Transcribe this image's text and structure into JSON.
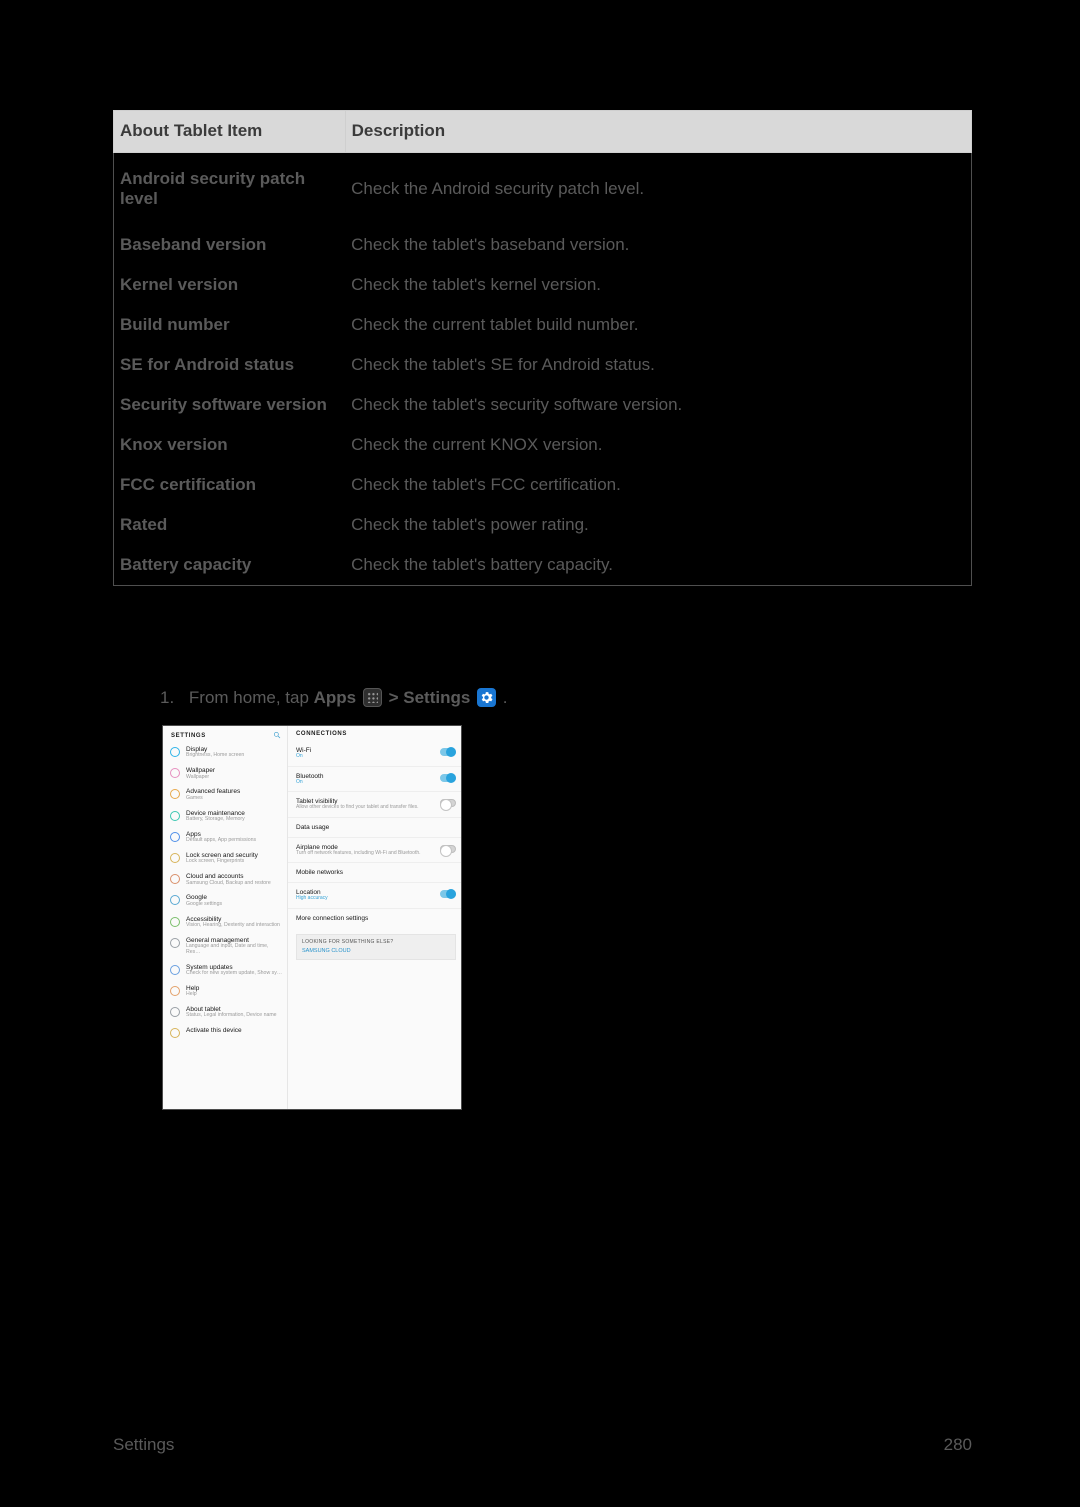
{
  "table": {
    "headers": {
      "item": "About Tablet Item",
      "desc": "Description"
    },
    "rows": [
      {
        "item": "Android security patch level",
        "desc": "Check the Android security patch level."
      },
      {
        "item": "Baseband version",
        "desc": "Check the tablet's baseband version."
      },
      {
        "item": "Kernel version",
        "desc": "Check the tablet's kernel version."
      },
      {
        "item": "Build number",
        "desc": "Check the current tablet build number."
      },
      {
        "item": "SE for Android status",
        "desc": "Check the tablet's SE for Android status."
      },
      {
        "item": "Security software version",
        "desc": "Check the tablet's security software version."
      },
      {
        "item": "Knox version",
        "desc": "Check the current KNOX version."
      },
      {
        "item": "FCC certification",
        "desc": "Check the tablet's FCC certification."
      },
      {
        "item": "Rated",
        "desc": "Check the tablet's power rating."
      },
      {
        "item": "Battery capacity",
        "desc": "Check the tablet's battery capacity."
      }
    ]
  },
  "instruction": {
    "num": "1.",
    "prefix": "From home, tap ",
    "apps": "Apps",
    "sep": " > ",
    "settings": "Settings",
    "period": "."
  },
  "screenshot": {
    "sidebar_title": "SETTINGS",
    "sidebar": [
      {
        "label": "Display",
        "sub": "Brightness, Home screen",
        "color": "#2fb4e8"
      },
      {
        "label": "Wallpaper",
        "sub": "Wallpaper",
        "color": "#e68fbf"
      },
      {
        "label": "Advanced features",
        "sub": "Games",
        "color": "#e7a84a"
      },
      {
        "label": "Device maintenance",
        "sub": "Battery, Storage, Memory",
        "color": "#3cc7b2"
      },
      {
        "label": "Apps",
        "sub": "Default apps, App permissions",
        "color": "#4f8fe8"
      },
      {
        "label": "Lock screen and security",
        "sub": "Lock screen, Fingerprints",
        "color": "#d7b45a"
      },
      {
        "label": "Cloud and accounts",
        "sub": "Samsung Cloud, Backup and restore",
        "color": "#d98f6a"
      },
      {
        "label": "Google",
        "sub": "Google settings",
        "color": "#5aa9d3"
      },
      {
        "label": "Accessibility",
        "sub": "Vision, Hearing, Dexterity and interaction",
        "color": "#7bbf6c"
      },
      {
        "label": "General management",
        "sub": "Language and input, Date and time, Res…",
        "color": "#9aa0a6"
      },
      {
        "label": "System updates",
        "sub": "Check for new system update, Show sy…",
        "color": "#6aa0e0"
      },
      {
        "label": "Help",
        "sub": "Help",
        "color": "#e3a16a"
      },
      {
        "label": "About tablet",
        "sub": "Status, Legal information, Device name",
        "color": "#9aa0a6"
      },
      {
        "label": "Activate this device",
        "sub": "",
        "color": "#d7b45a"
      }
    ],
    "panel_title": "CONNECTIONS",
    "panel": [
      {
        "label": "Wi-Fi",
        "sub": "On",
        "sub_accent": true,
        "toggle": "on"
      },
      {
        "label": "Bluetooth",
        "sub": "On",
        "sub_accent": true,
        "toggle": "on"
      },
      {
        "label": "Tablet visibility",
        "sub": "Allow other devices to find your tablet and transfer files.",
        "toggle": "off"
      },
      {
        "label": "Data usage",
        "sub": "",
        "toggle": null
      },
      {
        "label": "Airplane mode",
        "sub": "Turn off network features, including Wi-Fi and Bluetooth.",
        "toggle": "off"
      },
      {
        "label": "Mobile networks",
        "sub": "",
        "toggle": null
      },
      {
        "label": "Location",
        "sub": "High accuracy",
        "sub_accent": true,
        "toggle": "on"
      },
      {
        "label": "More connection settings",
        "sub": "",
        "toggle": null
      }
    ],
    "more_box": {
      "heading": "LOOKING FOR SOMETHING ELSE?",
      "link": "SAMSUNG CLOUD"
    }
  },
  "footer": {
    "left": "Settings",
    "right": "280"
  }
}
